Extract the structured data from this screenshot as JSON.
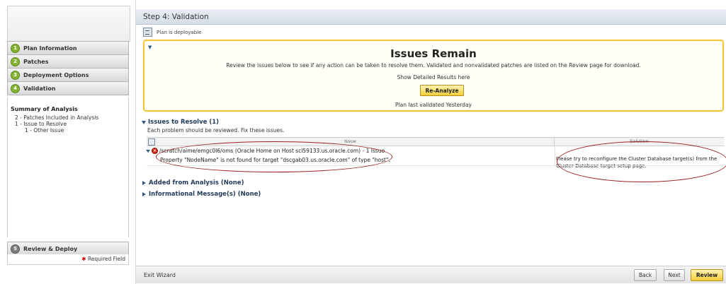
{
  "wizard": {
    "step_title": "Step 4: Validation",
    "deploy_status": "Plan is deployable"
  },
  "steps": [
    {
      "number": "1",
      "label": "Plan Information"
    },
    {
      "number": "2",
      "label": "Patches"
    },
    {
      "number": "3",
      "label": "Deployment Options"
    },
    {
      "number": "4",
      "label": "Validation"
    },
    {
      "number": "5",
      "label": "Review & Deploy"
    }
  ],
  "summary": {
    "title": "Summary of Analysis",
    "lines": [
      "2 - Patches Included in Analysis",
      "1 - Issue to Resolve",
      "1 - Other Issue"
    ]
  },
  "required_field": "Required Field",
  "issues_box": {
    "title": "Issues Remain",
    "description": "Review the issues below to see if any action can be taken to resolve them. Validated and nonvalidated patches are listed on the Review page for download.",
    "show_detailed": "Show Detailed Results  here",
    "reanalyze_label": "Re-Analyze",
    "last_validated": "Plan last validated Yesterday"
  },
  "issues_section": {
    "title": "Issues to Resolve (1)",
    "subtitle": "Each problem should be reviewed.  Fix these issues.",
    "columns": [
      "Issue",
      "Solution"
    ],
    "rows": [
      {
        "path": "/scratch/aime/emgc0l6/oms (Oracle Home on Host scl59133.us.oracle.com) - 1 Issue",
        "detail": "Property \"NodeName\" is not found for target \"dscgab03.us.oracle.com\" of type \"host\".",
        "solution": "Please try to reconfigure the Cluster Database target(s) from the Cluster Database target setup page."
      }
    ]
  },
  "added_section": {
    "title": "Added from Analysis (None)"
  },
  "info_section": {
    "title": "Informational Message(s) (None)"
  },
  "footer": {
    "exit_label": "Exit Wizard",
    "back_label": "Back",
    "next_label": "Next",
    "review_label": "Review"
  }
}
